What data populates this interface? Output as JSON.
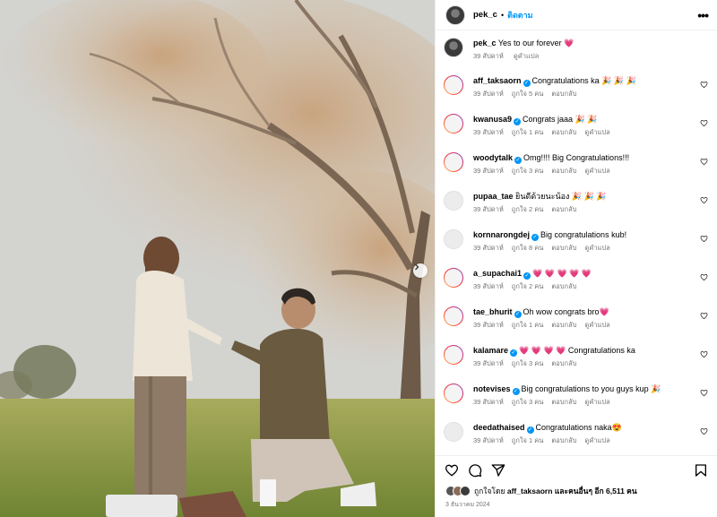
{
  "post": {
    "username": "pek_c",
    "separator": "•",
    "follow_label": "ติดตาม",
    "more_label": "•••",
    "caption": {
      "username": "pek_c",
      "text": "Yes to our forever 💗",
      "time": "39 สัปดาห์",
      "translate": "ดูคำแปล"
    }
  },
  "comments": [
    {
      "user": "aff_taksaorn",
      "verified": true,
      "text": "Congratulations ka 🎉 🎉 🎉",
      "time": "39 สัปดาห์",
      "likes": "ถูกใจ 5 คน",
      "reply": "ตอบกลับ",
      "translate": "",
      "avatar": "ring"
    },
    {
      "user": "kwanusa9",
      "verified": true,
      "text": "Congrats jaaa 🎉 🎉",
      "time": "39 สัปดาห์",
      "likes": "ถูกใจ 1 คน",
      "reply": "ตอบกลับ",
      "translate": "ดูคำแปล",
      "avatar": "ring"
    },
    {
      "user": "woodytalk",
      "verified": true,
      "text": "Omg!!!! Big Congratulations!!!",
      "time": "39 สัปดาห์",
      "likes": "ถูกใจ 3 คน",
      "reply": "ตอบกลับ",
      "translate": "ดูคำแปล",
      "avatar": "ring"
    },
    {
      "user": "pupaa_tae",
      "verified": false,
      "text": "ยินดีด้วยนะน้อง 🎉 🎉 🎉",
      "time": "39 สัปดาห์",
      "likes": "ถูกใจ 2 คน",
      "reply": "ตอบกลับ",
      "translate": "",
      "avatar": "plain"
    },
    {
      "user": "kornnarongdej",
      "verified": true,
      "text": "Big congratulations kub!",
      "time": "39 สัปดาห์",
      "likes": "ถูกใจ 8 คน",
      "reply": "ตอบกลับ",
      "translate": "ดูคำแปล",
      "avatar": "plain"
    },
    {
      "user": "a_supachai1",
      "verified": true,
      "text": "💗 💗 💗 💗 💗",
      "time": "39 สัปดาห์",
      "likes": "ถูกใจ 2 คน",
      "reply": "ตอบกลับ",
      "translate": "",
      "avatar": "ring"
    },
    {
      "user": "tae_bhurit",
      "verified": true,
      "text": "Oh wow congrats bro💗",
      "time": "39 สัปดาห์",
      "likes": "ถูกใจ 1 คน",
      "reply": "ตอบกลับ",
      "translate": "ดูคำแปล",
      "avatar": "ring"
    },
    {
      "user": "kalamare",
      "verified": true,
      "text": "💗 💗 💗 💗  Congratulations ka",
      "time": "39 สัปดาห์",
      "likes": "ถูกใจ 3 คน",
      "reply": "ตอบกลับ",
      "translate": "",
      "avatar": "ring"
    },
    {
      "user": "notevises",
      "verified": true,
      "text": "Big congratulations to you guys kup 🎉",
      "time": "39 สัปดาห์",
      "likes": "ถูกใจ 3 คน",
      "reply": "ตอบกลับ",
      "translate": "ดูคำแปล",
      "avatar": "ring"
    },
    {
      "user": "deedathaised",
      "verified": true,
      "text": "Congratulations naka😍",
      "time": "39 สัปดาห์",
      "likes": "ถูกใจ 1 คน",
      "reply": "ตอบกลับ",
      "translate": "ดูคำแปล",
      "avatar": "plain"
    }
  ],
  "footer": {
    "liked_prefix": "ถูกใจโดย",
    "liked_user": "aff_taksaorn",
    "liked_suffix": "และคนอื่นๆ อีก 6,511 คน",
    "date": "3 ธันวาคม 2024"
  },
  "icons": {
    "like": "heart-icon",
    "comment": "comment-icon",
    "share": "share-icon",
    "save": "bookmark-icon",
    "next": "chevron-right-icon"
  },
  "colors": {
    "accent": "#0095f6",
    "muted": "#737373"
  }
}
